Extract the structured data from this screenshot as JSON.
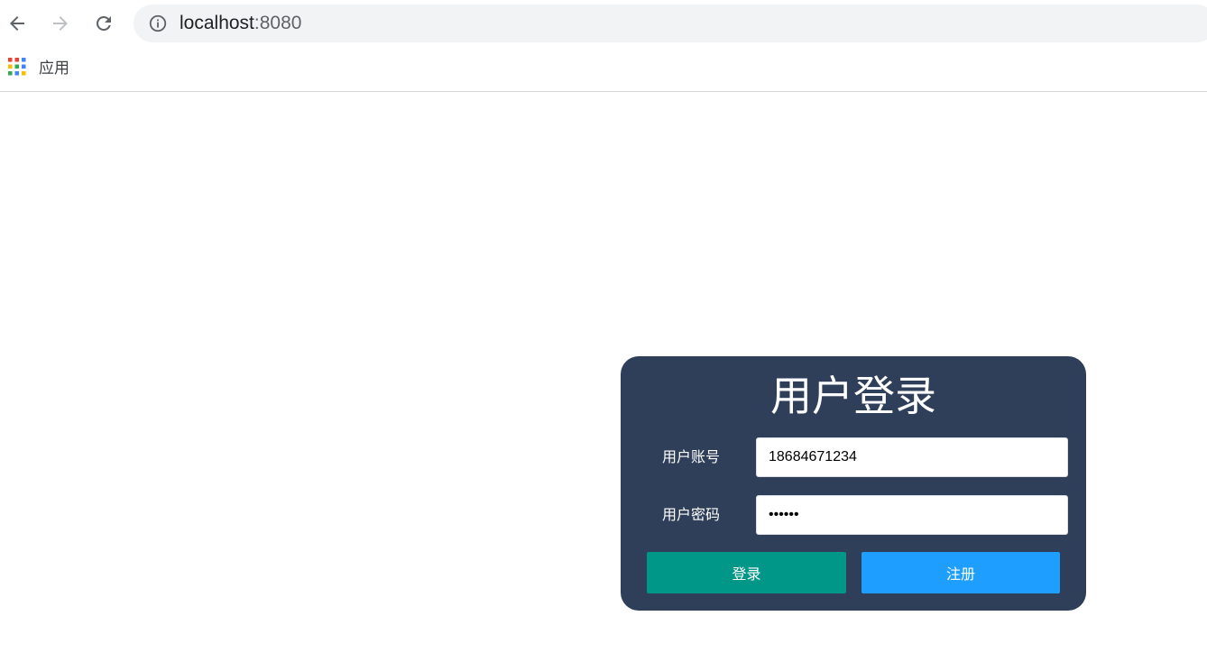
{
  "browser": {
    "address_host": "localhost",
    "address_port": ":8080",
    "bookmarks_apps_label": "应用",
    "colors": {
      "omnibox_bg": "#f1f3f4",
      "toolbar_icon": "#5f6368",
      "forward_disabled": "#bdc1c6"
    },
    "icons": [
      "back-arrow-icon",
      "forward-arrow-icon",
      "reload-icon",
      "info-icon",
      "apps-grid-icon"
    ]
  },
  "login": {
    "title": "用户登录",
    "account_label": "用户账号",
    "account_value": "18684671234",
    "password_label": "用户密码",
    "password_value": "123456",
    "login_button": "登录",
    "register_button": "注册",
    "colors": {
      "card_bg": "#2f3f59",
      "login_button_bg": "#009688",
      "register_button_bg": "#1e9fff"
    }
  }
}
